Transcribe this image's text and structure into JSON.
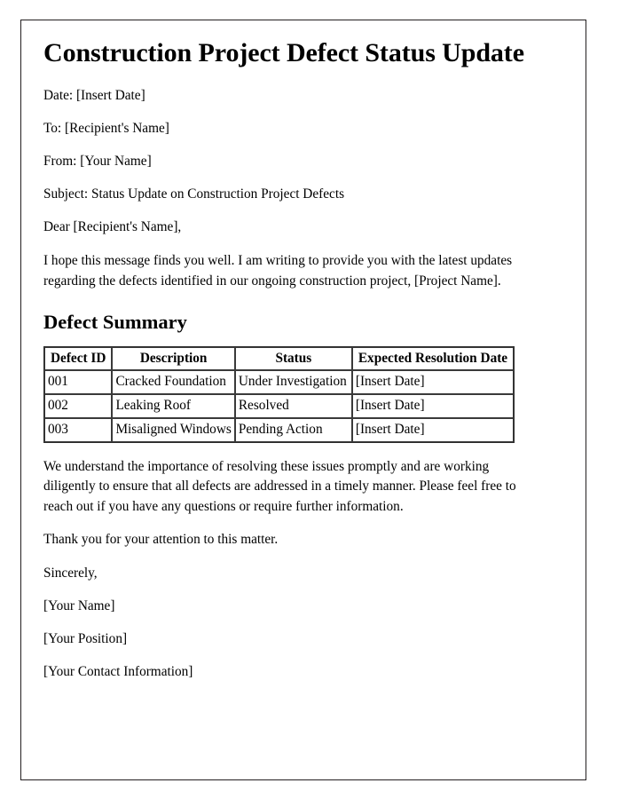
{
  "document": {
    "title": "Construction Project Defect Status Update",
    "header_lines": [
      "Date: [Insert Date]",
      "To: [Recipient's Name]",
      "From: [Your Name]",
      "Subject: Status Update on Construction Project Defects",
      "Dear [Recipient's Name],"
    ],
    "intro_paragraph": "I hope this message finds you well. I am writing to provide you with the latest updates regarding the defects identified in our ongoing construction project, [Project Name].",
    "section_heading": "Defect Summary",
    "table": {
      "columns": [
        "Defect ID",
        "Description",
        "Status",
        "Expected Resolution Date"
      ],
      "rows": [
        {
          "defect_id": "001",
          "description": "Cracked Foundation",
          "status": "Under Investigation",
          "expected_resolution_date": "[Insert Date]"
        },
        {
          "defect_id": "002",
          "description": "Leaking Roof",
          "status": "Resolved",
          "expected_resolution_date": "[Insert Date]"
        },
        {
          "defect_id": "003",
          "description": "Misaligned Windows",
          "status": "Pending Action",
          "expected_resolution_date": "[Insert Date]"
        }
      ]
    },
    "closing_paragraph": "We understand the importance of resolving these issues promptly and are working diligently to ensure that all defects are addressed in a timely manner. Please feel free to reach out if you have any questions or require further information.",
    "thanks_line": "Thank you for your attention to this matter.",
    "signature_lines": [
      "Sincerely,",
      "[Your Name]",
      "[Your Position]",
      "[Your Contact Information]"
    ]
  }
}
